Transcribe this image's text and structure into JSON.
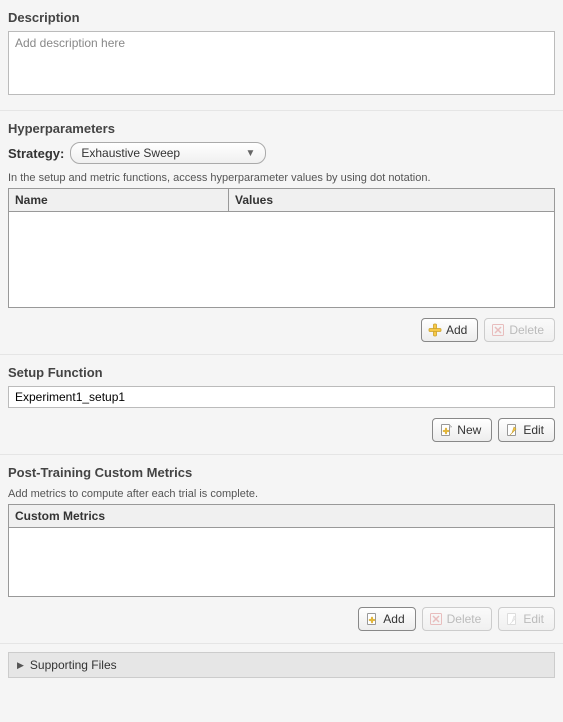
{
  "description": {
    "title": "Description",
    "placeholder": "Add description here"
  },
  "hyperparams": {
    "title": "Hyperparameters",
    "strategy_label": "Strategy:",
    "strategy_value": "Exhaustive Sweep",
    "hint": "In the setup and metric functions, access hyperparameter values by using dot notation.",
    "col_name": "Name",
    "col_values": "Values",
    "add_label": "Add",
    "delete_label": "Delete"
  },
  "setup_fn": {
    "title": "Setup Function",
    "value": "Experiment1_setup1",
    "new_label": "New",
    "edit_label": "Edit"
  },
  "metrics": {
    "title": "Post-Training Custom Metrics",
    "hint": "Add metrics to compute after each trial is complete.",
    "header": "Custom Metrics",
    "add_label": "Add",
    "delete_label": "Delete",
    "edit_label": "Edit"
  },
  "supporting": {
    "title": "Supporting Files"
  }
}
